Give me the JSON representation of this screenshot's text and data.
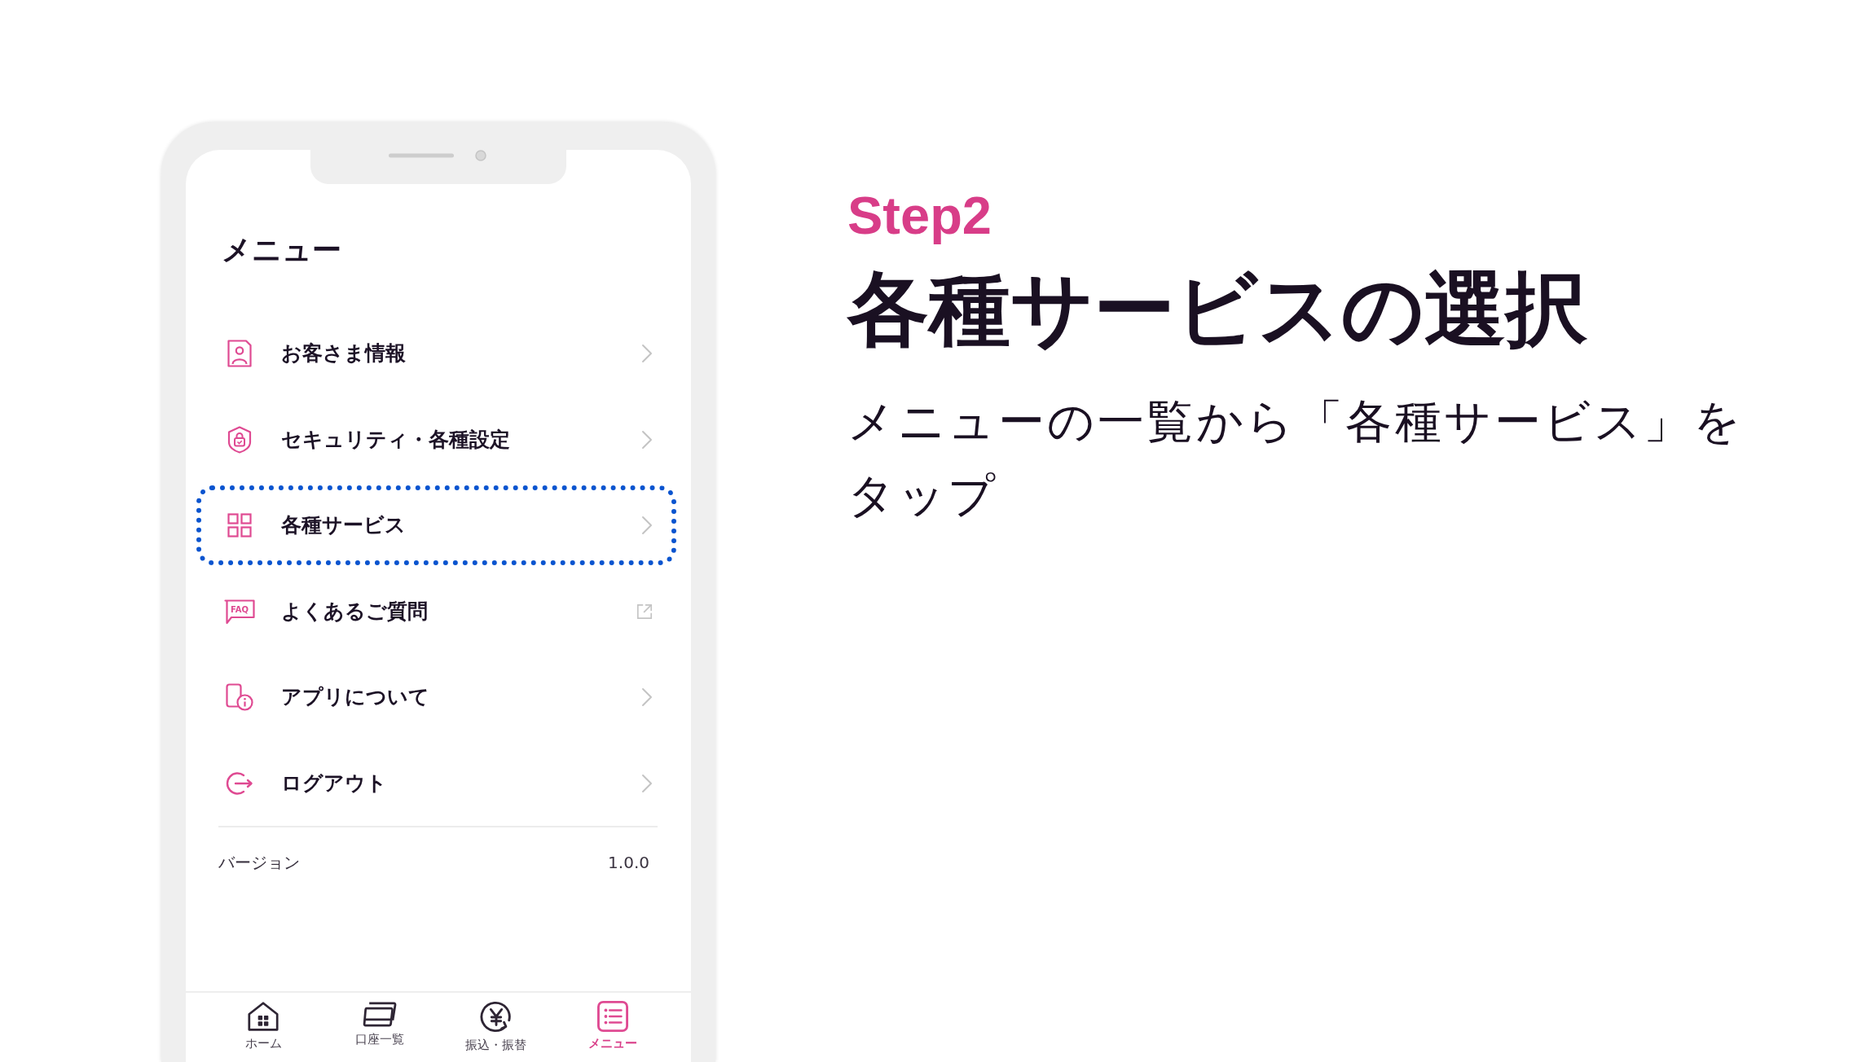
{
  "phone": {
    "title": "メニュー",
    "menu_items": [
      {
        "label": "お客さま情報",
        "kind": "page",
        "highlighted": false
      },
      {
        "label": "セキュリティ・各種設定",
        "kind": "page",
        "highlighted": false
      },
      {
        "label": "各種サービス",
        "kind": "page",
        "highlighted": true
      },
      {
        "label": "よくあるご質問",
        "kind": "external",
        "icon_text": "FAQ",
        "highlighted": false
      },
      {
        "label": "アプリについて",
        "kind": "page",
        "highlighted": false
      },
      {
        "label": "ログアウト",
        "kind": "page",
        "highlighted": false
      }
    ],
    "version": {
      "label": "バージョン",
      "value": "1.0.0"
    },
    "tab_bar": [
      {
        "label": "ホーム",
        "selected": false
      },
      {
        "label": "口座一覧",
        "selected": false
      },
      {
        "label": "振込・振替",
        "selected": false
      },
      {
        "label": "メニュー",
        "selected": true
      }
    ]
  },
  "step": "Step2",
  "heading": "各種サービスの選択",
  "description": "メニューの一覧から「各種サービス」をタップ"
}
